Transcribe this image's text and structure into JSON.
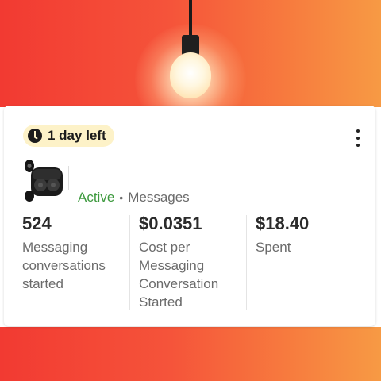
{
  "badge": {
    "label": "1 day left",
    "icon": "clock-icon"
  },
  "menu": {
    "icon": "more-vertical-icon"
  },
  "product": {
    "image": "earbuds-thumbnail"
  },
  "status": {
    "state": "Active",
    "separator": "•",
    "type": "Messages"
  },
  "metrics": [
    {
      "value": "524",
      "label_lines": [
        "Messaging",
        "conversations",
        "started"
      ]
    },
    {
      "value": "$0.0351",
      "label_lines": [
        "Cost per",
        "Messaging",
        "Conversation",
        "Started"
      ]
    },
    {
      "value": "$18.40",
      "label_lines": [
        "Spent"
      ]
    }
  ],
  "colors": {
    "active_status": "#3e9a3f",
    "badge_background": "#fdf2c8",
    "background_gradient": [
      "#f23a32",
      "#f79a44"
    ]
  }
}
